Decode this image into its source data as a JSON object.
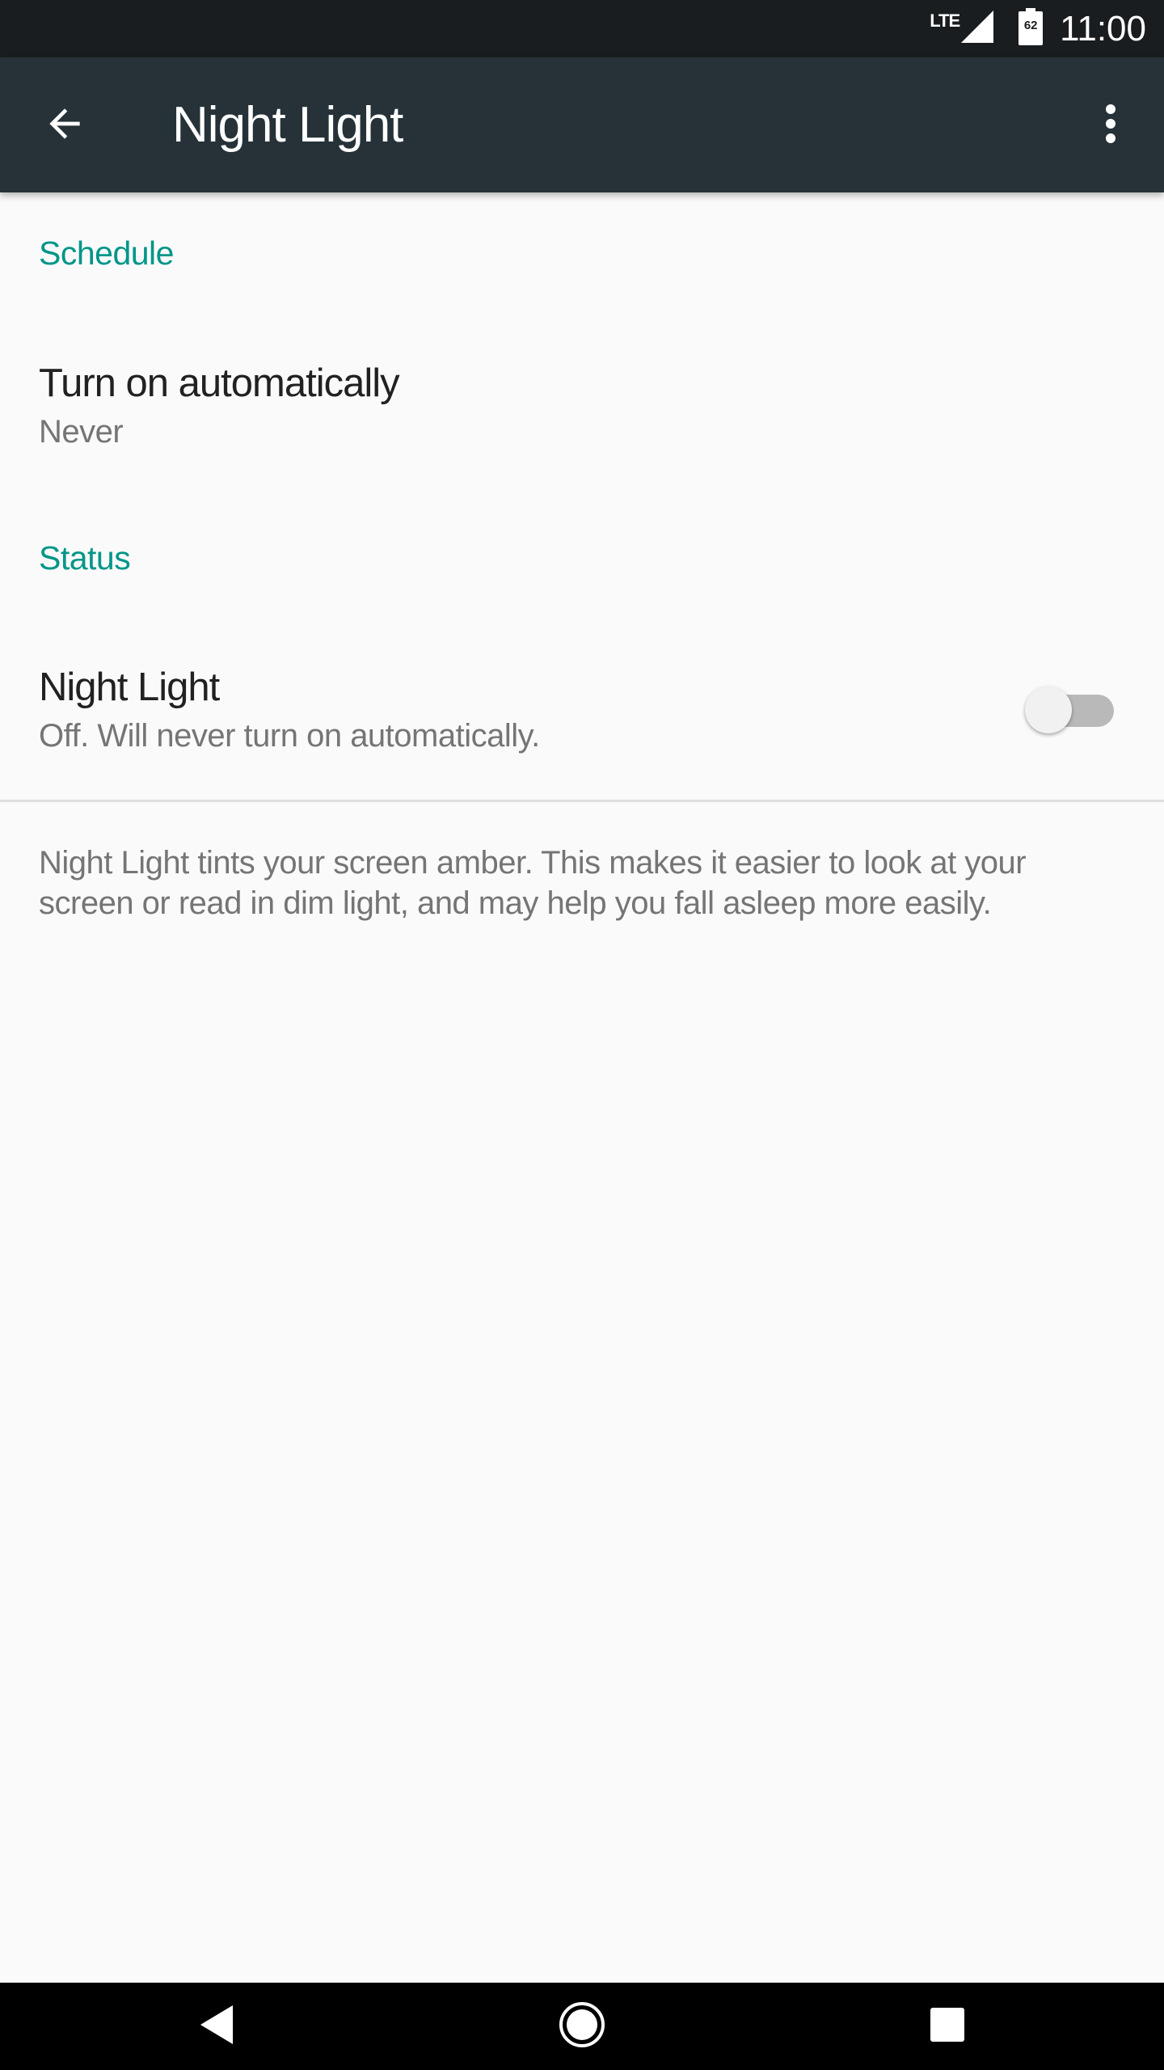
{
  "status_bar": {
    "network_label": "LTE",
    "battery_level": "62",
    "time": "11:00",
    "icons": [
      "signal-icon",
      "battery-icon"
    ]
  },
  "app_bar": {
    "title": "Night Light",
    "icons": [
      "back-arrow-icon",
      "more-vert-icon"
    ],
    "color": "#263238"
  },
  "sections": {
    "schedule": {
      "header": "Schedule",
      "item_title": "Turn on automatically",
      "item_summary": "Never"
    },
    "status": {
      "header": "Status",
      "item_title": "Night Light",
      "item_summary": "Off. Will never turn on automatically.",
      "switch_on": false
    }
  },
  "footer": {
    "description": "Night Light tints your screen amber. This makes it easier to look at your screen or read in dim light, and may help you fall asleep more easily."
  },
  "nav_bar": {
    "icons": [
      "back-triangle-icon",
      "home-circle-icon",
      "recents-square-icon"
    ]
  },
  "colors": {
    "accent": "#009688",
    "status_bar_bg": "#1a1d20",
    "background": "#fafafa"
  }
}
